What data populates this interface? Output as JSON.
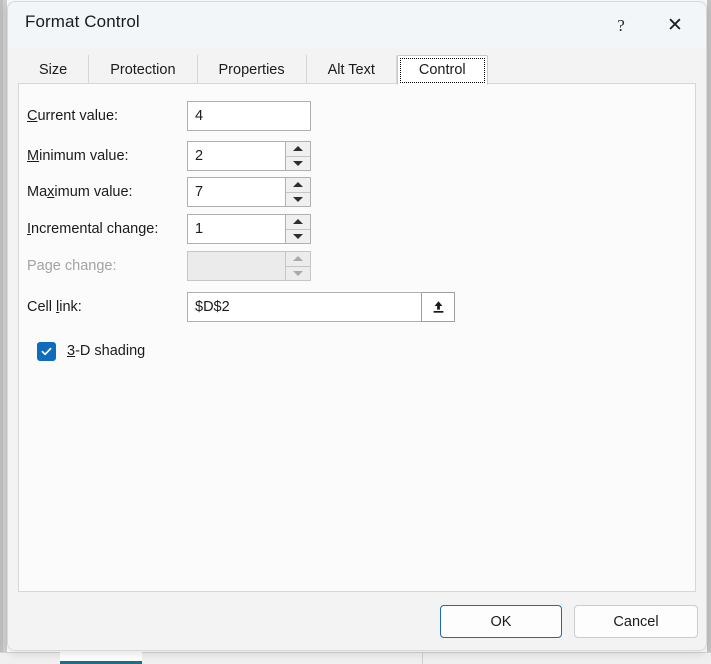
{
  "window": {
    "title": "Format Control",
    "help_glyph": "?",
    "close_glyph": "✕"
  },
  "tabs": [
    {
      "label": "Size",
      "selected": false
    },
    {
      "label": "Protection",
      "selected": false
    },
    {
      "label": "Properties",
      "selected": false
    },
    {
      "label": "Alt Text",
      "selected": false
    },
    {
      "label": "Control",
      "selected": true
    }
  ],
  "form": {
    "rows": [
      {
        "name": "current-value",
        "label_pre": "",
        "label_accel": "C",
        "label_post": "urrent value:",
        "value": "4",
        "spinner": false,
        "disabled": false
      },
      {
        "name": "minimum-value",
        "label_pre": "",
        "label_accel": "M",
        "label_post": "inimum value:",
        "value": "2",
        "spinner": true,
        "disabled": false
      },
      {
        "name": "maximum-value",
        "label_pre": "Ma",
        "label_accel": "x",
        "label_post": "imum value:",
        "value": "7",
        "spinner": true,
        "disabled": false
      },
      {
        "name": "incremental-change",
        "label_pre": "",
        "label_accel": "I",
        "label_post": "ncremental change:",
        "value": "1",
        "spinner": true,
        "disabled": false
      },
      {
        "name": "page-change",
        "label_pre": "Page change:",
        "label_accel": "",
        "label_post": "",
        "value": "",
        "spinner": true,
        "disabled": true
      }
    ],
    "cell_link": {
      "label_pre": "Cell ",
      "label_accel": "l",
      "label_post": "ink:",
      "value": "$D$2",
      "range_icon": "collapse-dialog-icon"
    },
    "shading_checkbox": {
      "checked": true,
      "label_accel": "3",
      "label_post": "-D shading",
      "check_glyph": "✓",
      "accent_color": "#0f6cbd"
    }
  },
  "footer": {
    "ok_label": "OK",
    "cancel_label": "Cancel",
    "default_button_border": "#1b6ea8"
  },
  "background": {
    "sheet_tab_active_color": "#1b6e8c",
    "selected_cell_color": "#8aa469"
  }
}
